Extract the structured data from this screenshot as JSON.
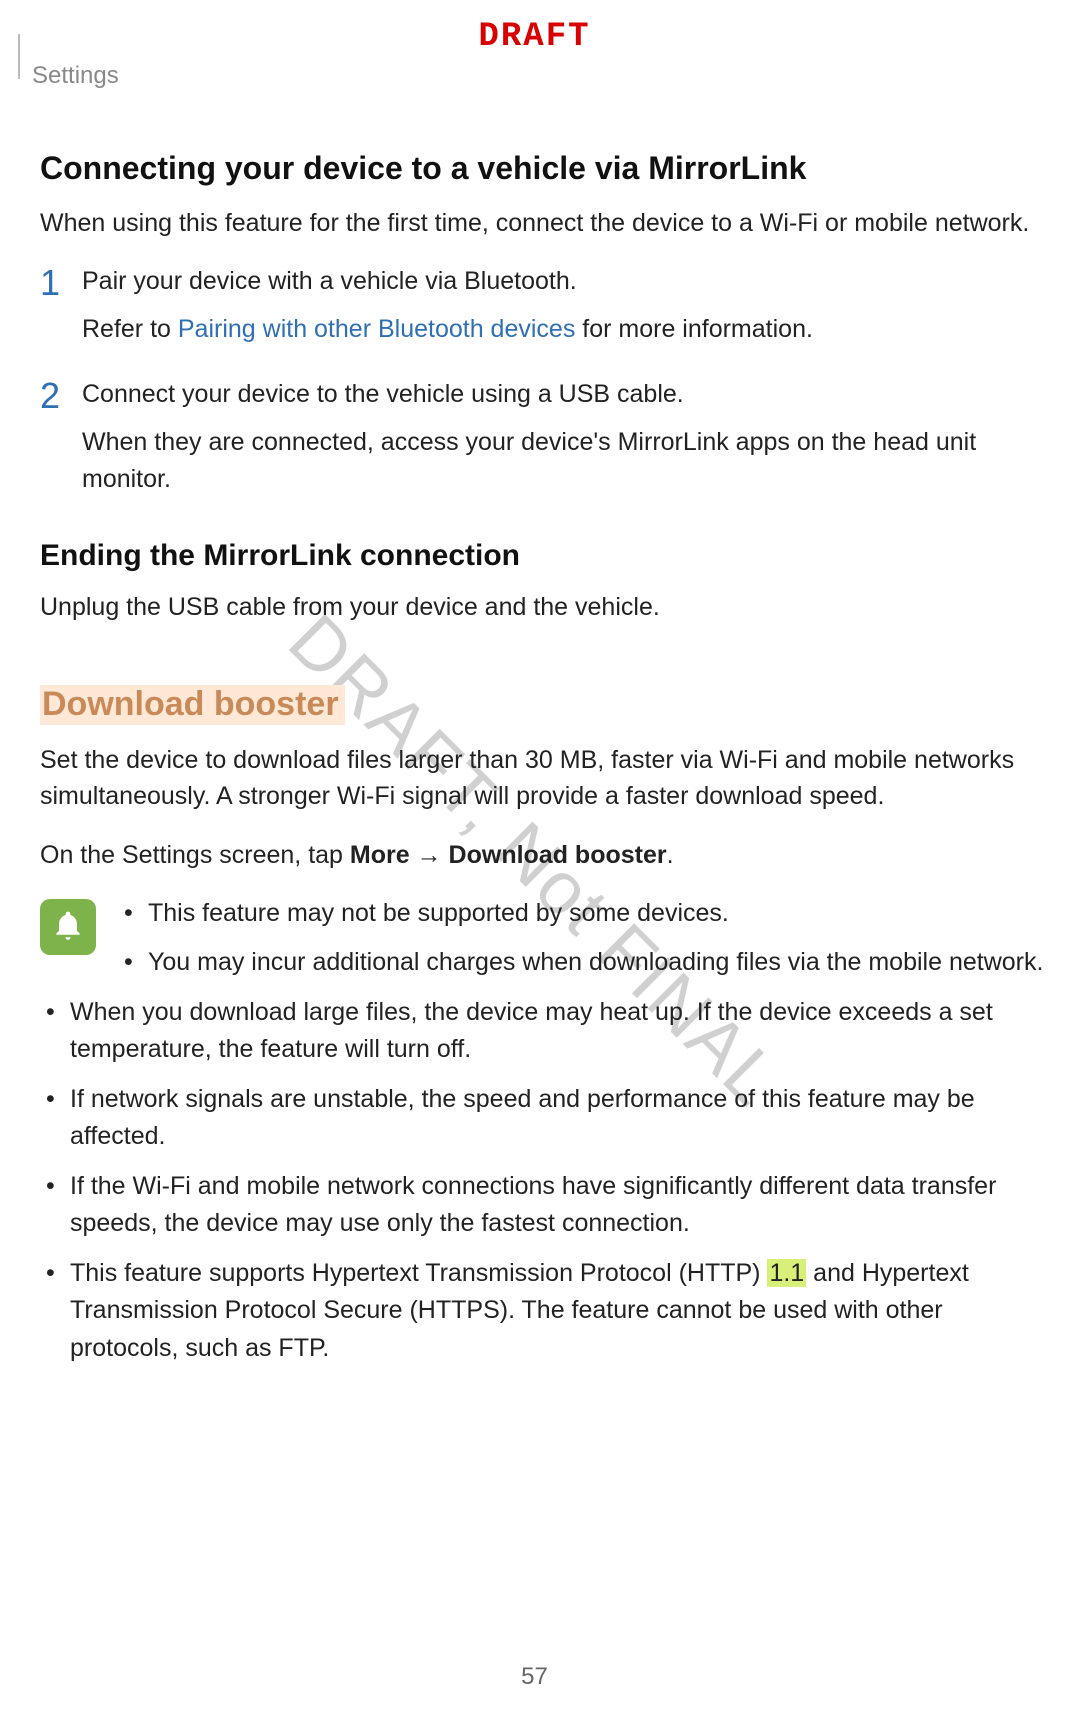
{
  "banner": "DRAFT",
  "header": "Settings",
  "watermark": "DRAFT, Not FINAL",
  "page_number": "57",
  "section1": {
    "title": "Connecting your device to a vehicle via MirrorLink",
    "intro": "When using this feature for the first time, connect the device to a Wi-Fi or mobile network.",
    "steps": [
      {
        "num": "1",
        "line1": "Pair your device with a vehicle via Bluetooth.",
        "sub_prefix": "Refer to ",
        "sub_link": "Pairing with other Bluetooth devices",
        "sub_suffix": " for more information."
      },
      {
        "num": "2",
        "line1": "Connect your device to the vehicle using a USB cable.",
        "sub": "When they are connected, access your device's MirrorLink apps on the head unit monitor."
      }
    ]
  },
  "section2": {
    "title": "Ending the MirrorLink connection",
    "body": "Unplug the USB cable from your device and the vehicle."
  },
  "section3": {
    "title": "Download booster",
    "p1": "Set the device to download files larger than 30 MB, faster via Wi-Fi and mobile networks simultaneously. A stronger Wi-Fi signal will provide a faster download speed.",
    "p2_prefix": "On the Settings screen, tap ",
    "p2_strong1": "More",
    "p2_arrow": " → ",
    "p2_strong2": "Download booster",
    "p2_suffix": ".",
    "notes": [
      "This feature may not be supported by some devices.",
      "You may incur additional charges when downloading files via the mobile network.",
      "When you download large files, the device may heat up. If the device exceeds a set temperature, the feature will turn off.",
      "If network signals are unstable, the speed and performance of this feature may be affected.",
      "If the Wi-Fi and mobile network connections have significantly different data transfer speeds, the device may use only the fastest connection."
    ],
    "note6_a": "This feature supports Hypertext Transmission Protocol (HTTP) ",
    "note6_hl": "1.1",
    "note6_b": " and Hypertext Transmission Protocol Secure (HTTPS). The feature cannot be used with other protocols, such as FTP."
  }
}
